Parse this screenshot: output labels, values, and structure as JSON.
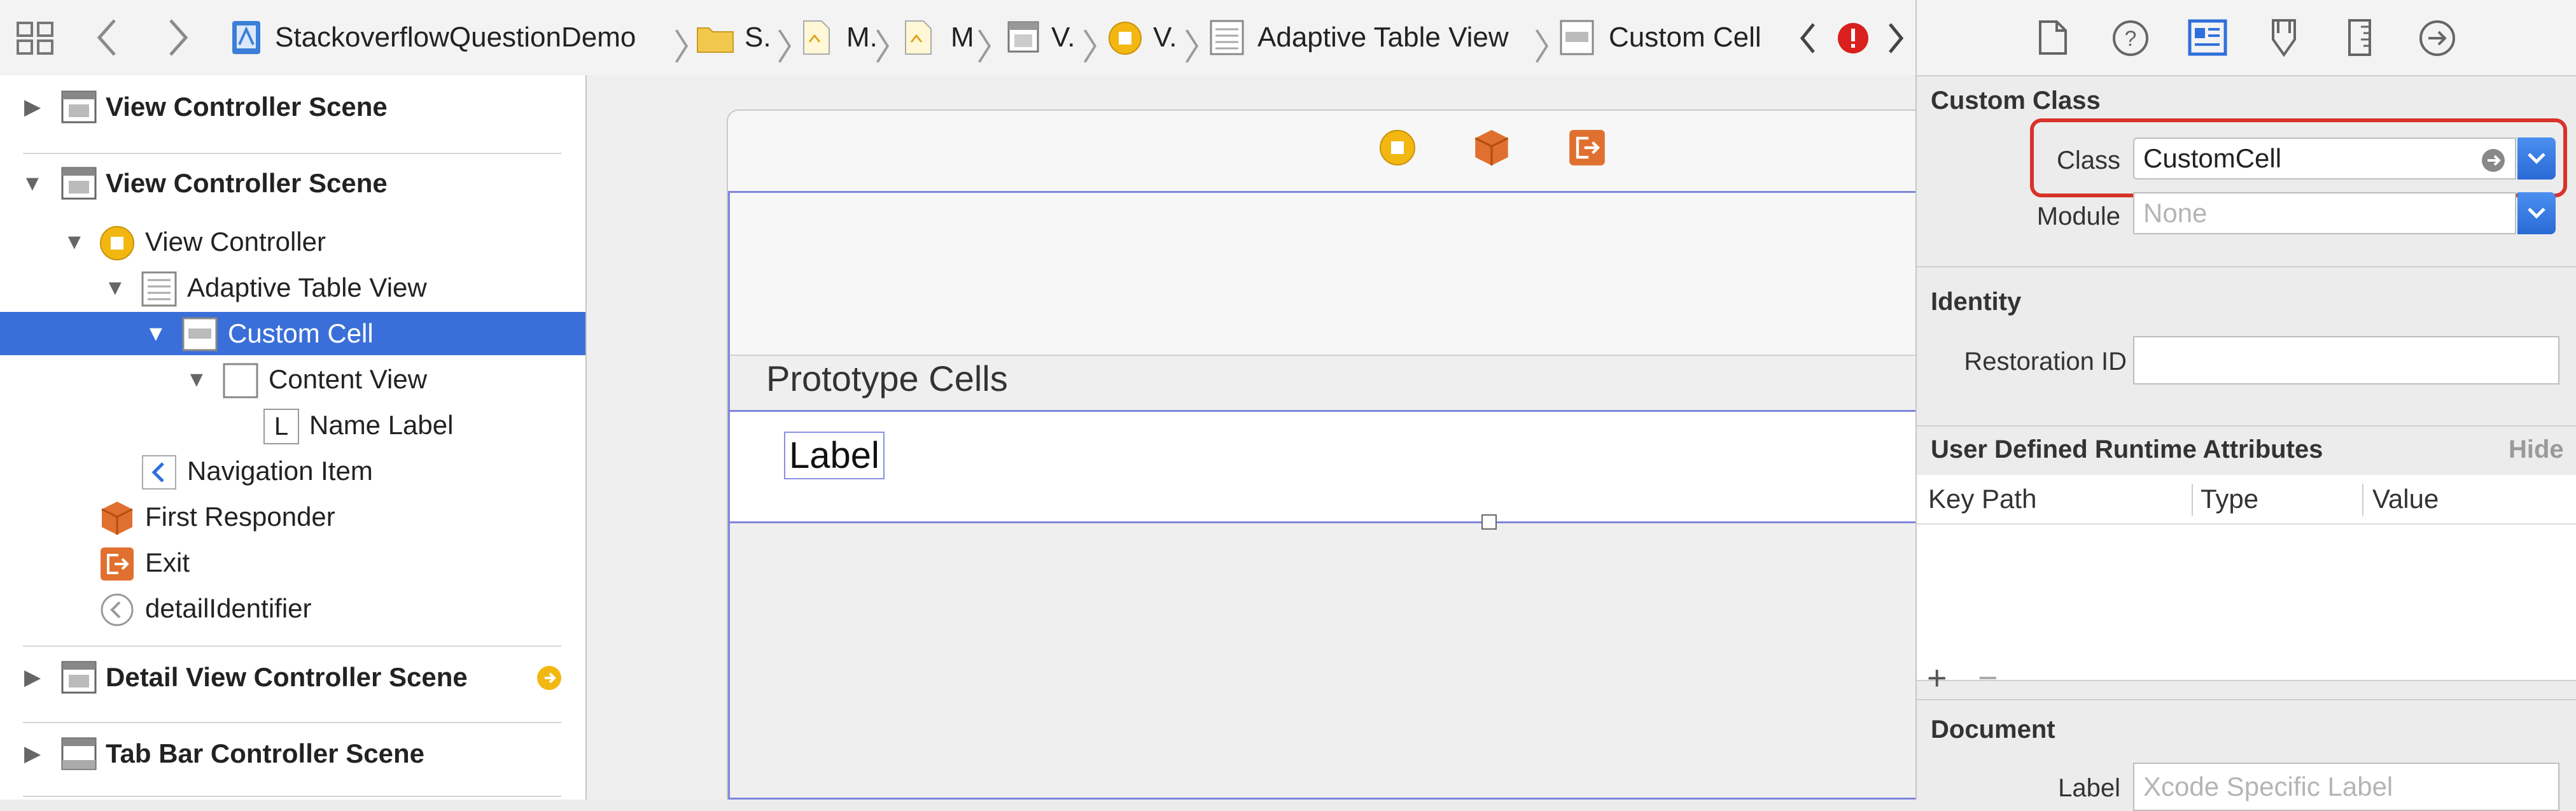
{
  "jumpbar": {
    "project": "StackoverflowQuestionDemo",
    "crumb_folder": "S.",
    "crumb_m1": "M.",
    "crumb_m2": "M",
    "crumb_v1": "V.",
    "crumb_v2": "V.",
    "crumb_table": "Adaptive Table View",
    "crumb_cell": "Custom Cell"
  },
  "outline": {
    "scene1": "View Controller Scene",
    "scene2": "View Controller Scene",
    "view_controller": "View Controller",
    "adaptive_table_view": "Adaptive Table View",
    "custom_cell": "Custom Cell",
    "content_view": "Content View",
    "label_glyph": "L",
    "name_label": "Name Label",
    "navigation_item": "Navigation Item",
    "first_responder": "First Responder",
    "exit": "Exit",
    "detail_identifier": "detailIdentifier",
    "detail_scene": "Detail View Controller Scene",
    "tab_bar_scene": "Tab Bar Controller Scene"
  },
  "canvas": {
    "prototype_cells": "Prototype Cells",
    "cell_label": "Label"
  },
  "inspector": {
    "custom_class": {
      "title": "Custom Class",
      "class_label": "Class",
      "class_value": "CustomCell",
      "module_label": "Module",
      "module_placeholder": "None"
    },
    "identity": {
      "title": "Identity",
      "restoration_label": "Restoration ID",
      "restoration_value": ""
    },
    "runtime": {
      "title": "User Defined Runtime Attributes",
      "hide": "Hide",
      "col_key_path": "Key Path",
      "col_type": "Type",
      "col_value": "Value",
      "add": "+",
      "remove": "−"
    },
    "document": {
      "title": "Document",
      "label_label": "Label",
      "label_placeholder": "Xcode Specific Label"
    }
  },
  "colors": {
    "selection": "#3a6fd9",
    "highlight_box": "#d8332a",
    "accent_blue": "#2f6fdc",
    "error_red": "#d9201c",
    "vc_yellow": "#f2b711",
    "orange": "#e07030"
  }
}
